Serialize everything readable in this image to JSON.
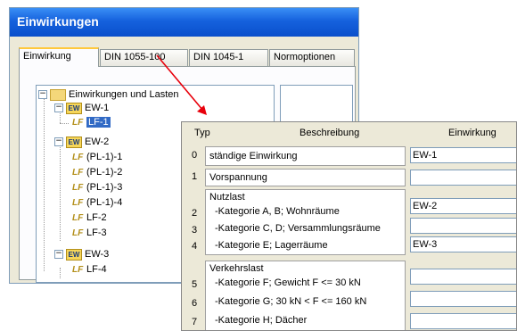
{
  "window": {
    "title": "Einwirkungen"
  },
  "tabs": [
    {
      "label": "Einwirkung",
      "active": true
    },
    {
      "label": "DIN 1055-100",
      "active": false
    },
    {
      "label": "DIN 1045-1",
      "active": false
    },
    {
      "label": "Normoptionen",
      "active": false
    }
  ],
  "tree": {
    "root": "Einwirkungen und Lasten",
    "ew_icon": "EW",
    "lf_icon": "LF",
    "ew1": "EW-1",
    "lf1": "LF-1",
    "ew2": "EW-2",
    "pl1": "(PL-1)-1",
    "pl2": "(PL-1)-2",
    "pl3": "(PL-1)-3",
    "pl4": "(PL-1)-4",
    "lf2": "LF-2",
    "lf3": "LF-3",
    "ew3": "EW-3",
    "lf4": "LF-4",
    "expanded_sign": "−"
  },
  "popup": {
    "headers": {
      "typ": "Typ",
      "beschreibung": "Beschreibung",
      "einwirkung": "Einwirkung"
    },
    "rows": [
      {
        "num": "0",
        "group": "",
        "text": "ständige Einwirkung",
        "value": "EW-1"
      },
      {
        "num": "1",
        "group": "",
        "text": "Vorspannung",
        "value": ""
      },
      {
        "num": "2",
        "group": "Nutzlast",
        "text": "-Kategorie A, B; Wohnräume",
        "value": "EW-2"
      },
      {
        "num": "3",
        "group": "",
        "text": "-Kategorie C, D; Versammlungsräume",
        "value": ""
      },
      {
        "num": "4",
        "group": "",
        "text": "-Kategorie E; Lagerräume",
        "value": "EW-3"
      },
      {
        "num": "5",
        "group": "Verkehrslast",
        "text": "-Kategorie F; Gewicht F <= 30 kN",
        "value": ""
      },
      {
        "num": "6",
        "group": "",
        "text": "-Kategorie G; 30 kN < F <= 160 kN",
        "value": ""
      },
      {
        "num": "7",
        "group": "",
        "text": "-Kategorie H; Dächer",
        "value": ""
      }
    ]
  },
  "arrow_color": "#e8000b"
}
